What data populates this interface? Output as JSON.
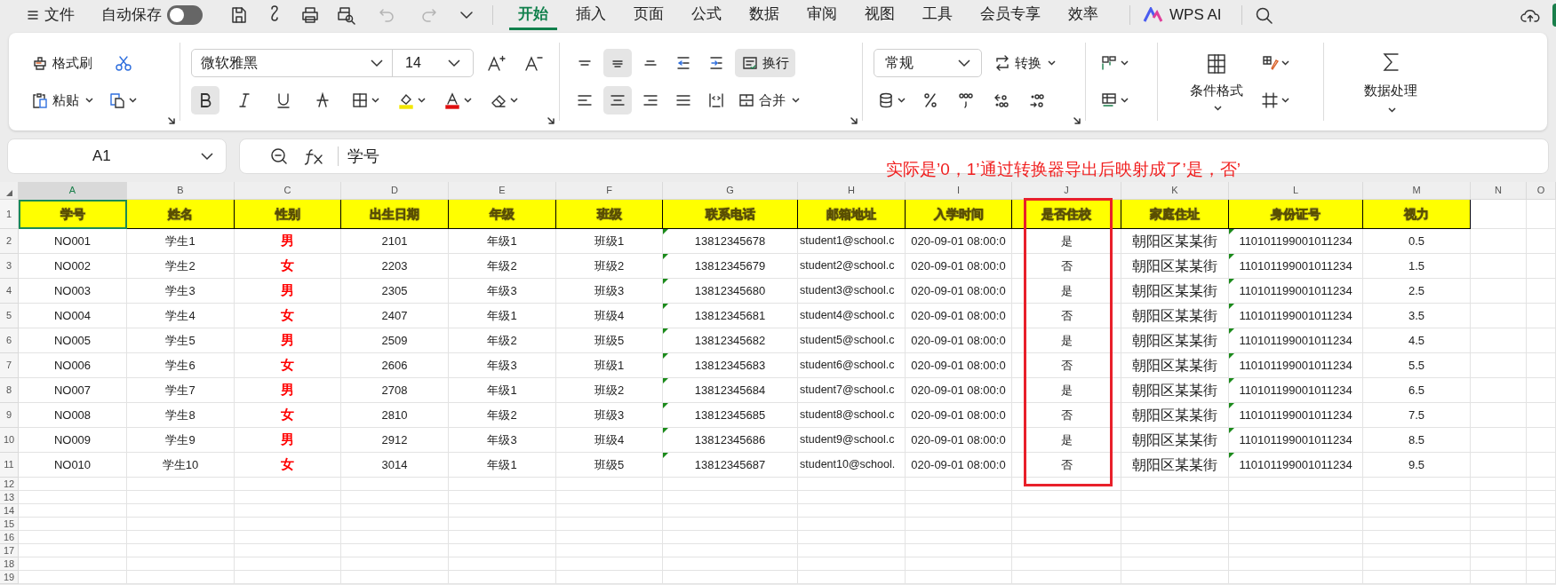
{
  "menu_bar": {
    "file": "文件",
    "autosave": {
      "label": "自动保存",
      "on": false
    },
    "quick_access": {
      "undo": {
        "disabled": true
      },
      "redo": {
        "disabled": true
      }
    },
    "tabs": [
      {
        "label": "开始",
        "selected": true
      },
      {
        "label": "插入",
        "selected": false
      },
      {
        "label": "页面",
        "selected": false
      },
      {
        "label": "公式",
        "selected": false
      },
      {
        "label": "数据",
        "selected": false
      },
      {
        "label": "审阅",
        "selected": false
      },
      {
        "label": "视图",
        "selected": false
      },
      {
        "label": "工具",
        "selected": false
      },
      {
        "label": "会员专享",
        "selected": false
      },
      {
        "label": "效率",
        "selected": false
      }
    ],
    "ai": "WPS AI"
  },
  "ribbon": {
    "format_painter": "格式刷",
    "paste": "粘贴",
    "font": "微软雅黑",
    "font_size": "14",
    "toggles": [
      {
        "kind": "bold",
        "pressed": true
      },
      {
        "kind": "italic",
        "pressed": false
      },
      {
        "kind": "underline",
        "pressed": false
      },
      {
        "kind": "strike",
        "pressed": false
      }
    ],
    "alignment": [
      {
        "kind": "top",
        "pressed": false
      },
      {
        "kind": "middle",
        "pressed": true
      },
      {
        "kind": "bottom",
        "pressed": false
      },
      {
        "kind": "indent_less",
        "pressed": false
      },
      {
        "kind": "indent_more",
        "pressed": false
      },
      {
        "kind": "left",
        "pressed": false
      },
      {
        "kind": "center",
        "pressed": true
      },
      {
        "kind": "right",
        "pressed": false
      },
      {
        "kind": "justify",
        "pressed": false
      },
      {
        "kind": "distribute",
        "pressed": false
      }
    ],
    "wrap": {
      "label": "换行",
      "pressed": true
    },
    "merge": "合并",
    "number_format": "常规",
    "convert": "转换",
    "conditional_format": "条件格式",
    "data_processing": "数据处理"
  },
  "formula_bar": {
    "cell_ref": "A1",
    "value": "学号"
  },
  "annotation": "实际是’0，1’通过转换器导出后映射成了’是，否’",
  "sheet": {
    "columns": [
      {
        "letter": "A",
        "header": "学号",
        "selected": true
      },
      {
        "letter": "B",
        "header": "姓名",
        "selected": false
      },
      {
        "letter": "C",
        "header": "性别",
        "selected": false,
        "color": "#ff0000"
      },
      {
        "letter": "D",
        "header": "出生日期",
        "selected": false
      },
      {
        "letter": "E",
        "header": "年级",
        "selected": false
      },
      {
        "letter": "F",
        "header": "班级",
        "selected": false
      },
      {
        "letter": "G",
        "header": "联系电话",
        "selected": false,
        "flagged": true
      },
      {
        "letter": "H",
        "header": "邮箱地址",
        "selected": false
      },
      {
        "letter": "I",
        "header": "入学时间",
        "selected": false
      },
      {
        "letter": "J",
        "header": "是否住校",
        "selected": false
      },
      {
        "letter": "K",
        "header": "家庭住址",
        "selected": false
      },
      {
        "letter": "L",
        "header": "身份证号",
        "selected": false,
        "flagged": true
      },
      {
        "letter": "M",
        "header": "视力",
        "selected": false
      },
      {
        "letter": "N",
        "selected": false
      },
      {
        "letter": "O",
        "selected": false
      }
    ],
    "row_labels": [
      "1",
      "2",
      "3",
      "4",
      "5",
      "6",
      "7",
      "8",
      "9",
      "10",
      "11",
      "12",
      "13",
      "14",
      "15",
      "16",
      "17",
      "18",
      "19"
    ],
    "rows": [
      [
        "NO001",
        "学生1",
        "男",
        "2101",
        "年级1",
        "班级1",
        "13812345678",
        "student1@school.c",
        "020-09-01 08:00:0",
        "是",
        "朝阳区某某街",
        "110101199001011234",
        "0.5"
      ],
      [
        "NO002",
        "学生2",
        "女",
        "2203",
        "年级2",
        "班级2",
        "13812345679",
        "student2@school.c",
        "020-09-01 08:00:0",
        "否",
        "朝阳区某某街",
        "110101199001011234",
        "1.5"
      ],
      [
        "NO003",
        "学生3",
        "男",
        "2305",
        "年级3",
        "班级3",
        "13812345680",
        "student3@school.c",
        "020-09-01 08:00:0",
        "是",
        "朝阳区某某街",
        "110101199001011234",
        "2.5"
      ],
      [
        "NO004",
        "学生4",
        "女",
        "2407",
        "年级1",
        "班级4",
        "13812345681",
        "student4@school.c",
        "020-09-01 08:00:0",
        "否",
        "朝阳区某某街",
        "110101199001011234",
        "3.5"
      ],
      [
        "NO005",
        "学生5",
        "男",
        "2509",
        "年级2",
        "班级5",
        "13812345682",
        "student5@school.c",
        "020-09-01 08:00:0",
        "是",
        "朝阳区某某街",
        "110101199001011234",
        "4.5"
      ],
      [
        "NO006",
        "学生6",
        "女",
        "2606",
        "年级3",
        "班级1",
        "13812345683",
        "student6@school.c",
        "020-09-01 08:00:0",
        "否",
        "朝阳区某某街",
        "110101199001011234",
        "5.5"
      ],
      [
        "NO007",
        "学生7",
        "男",
        "2708",
        "年级1",
        "班级2",
        "13812345684",
        "student7@school.c",
        "020-09-01 08:00:0",
        "是",
        "朝阳区某某街",
        "110101199001011234",
        "6.5"
      ],
      [
        "NO008",
        "学生8",
        "女",
        "2810",
        "年级2",
        "班级3",
        "13812345685",
        "student8@school.c",
        "020-09-01 08:00:0",
        "否",
        "朝阳区某某街",
        "110101199001011234",
        "7.5"
      ],
      [
        "NO009",
        "学生9",
        "男",
        "2912",
        "年级3",
        "班级4",
        "13812345686",
        "student9@school.c",
        "020-09-01 08:00:0",
        "是",
        "朝阳区某某街",
        "110101199001011234",
        "8.5"
      ],
      [
        "NO010",
        "学生10",
        "女",
        "3014",
        "年级1",
        "班级5",
        "13812345687",
        "student10@school.",
        "020-09-01 08:00:0",
        "否",
        "朝阳区某某街",
        "110101199001011234",
        "9.5"
      ]
    ]
  }
}
